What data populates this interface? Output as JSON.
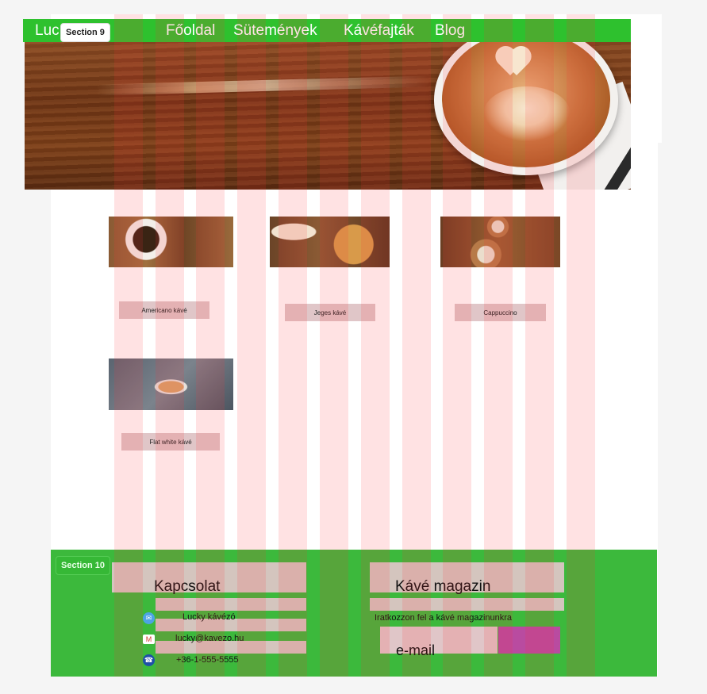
{
  "sections": {
    "header_label": "Section 9",
    "footer_label": "Section 10"
  },
  "header": {
    "logo": "Luc",
    "nav": [
      "Főoldal",
      "Sütemények",
      "Kávéfajták",
      "Blog"
    ]
  },
  "products": [
    {
      "name": "Americano kávé"
    },
    {
      "name": "Jeges kávé"
    },
    {
      "name": "Cappuccino"
    },
    {
      "name": "Flat white kávé"
    }
  ],
  "footer": {
    "contact": {
      "title": "Kapcsolat",
      "name": "Lucky kávézó",
      "email": "lucky@kavezo.hu",
      "phone": "+36-1-555-5555"
    },
    "magazine": {
      "title": "Kávé magazin",
      "text": "Iratkozzon fel a kávé magazinunkra",
      "email_placeholder": "e-mail"
    }
  },
  "icons": {
    "contact_name": "envelope-icon",
    "contact_email": "gmail-icon",
    "contact_phone": "phone-icon"
  },
  "colors": {
    "nav_green": "#2ec12e",
    "footer_green": "#3cb93c",
    "label_pink": "#e0c6c8",
    "button_magenta": "#b94ba0",
    "grid_overlay": "rgba(255,50,60,0.14)"
  }
}
